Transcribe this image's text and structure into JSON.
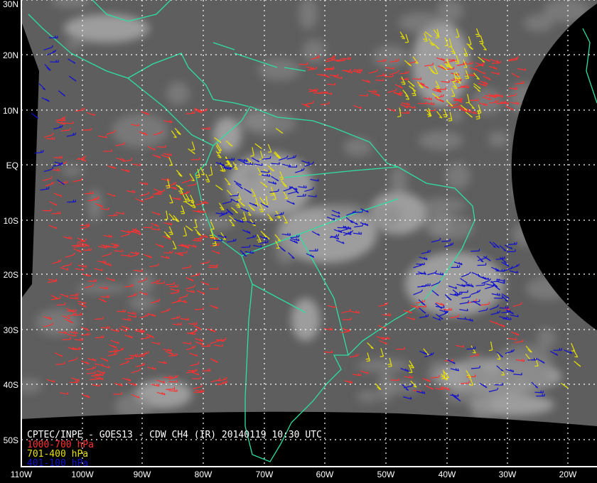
{
  "title": "CPTEC/INPE - GOES13 - CDW CH4 (IR) 20140119 10:30 UTC",
  "legend": [
    {
      "label": "1000-700 hPa",
      "color": "#ff3030"
    },
    {
      "label": "701-400 hPa",
      "color": "#e8e000"
    },
    {
      "label": "401-100 hPa",
      "color": "#1010d0"
    }
  ],
  "lat_labels": [
    "30N",
    "20N",
    "10N",
    "EQ",
    "10S",
    "20S",
    "30S",
    "40S",
    "50S"
  ],
  "lon_labels": [
    "110W",
    "100W",
    "90W",
    "80W",
    "70W",
    "60W",
    "50W",
    "40W",
    "30W",
    "20W"
  ],
  "colors": {
    "coastline": "#2ee0a0",
    "grid": "#ffffff",
    "background": "#000000"
  }
}
